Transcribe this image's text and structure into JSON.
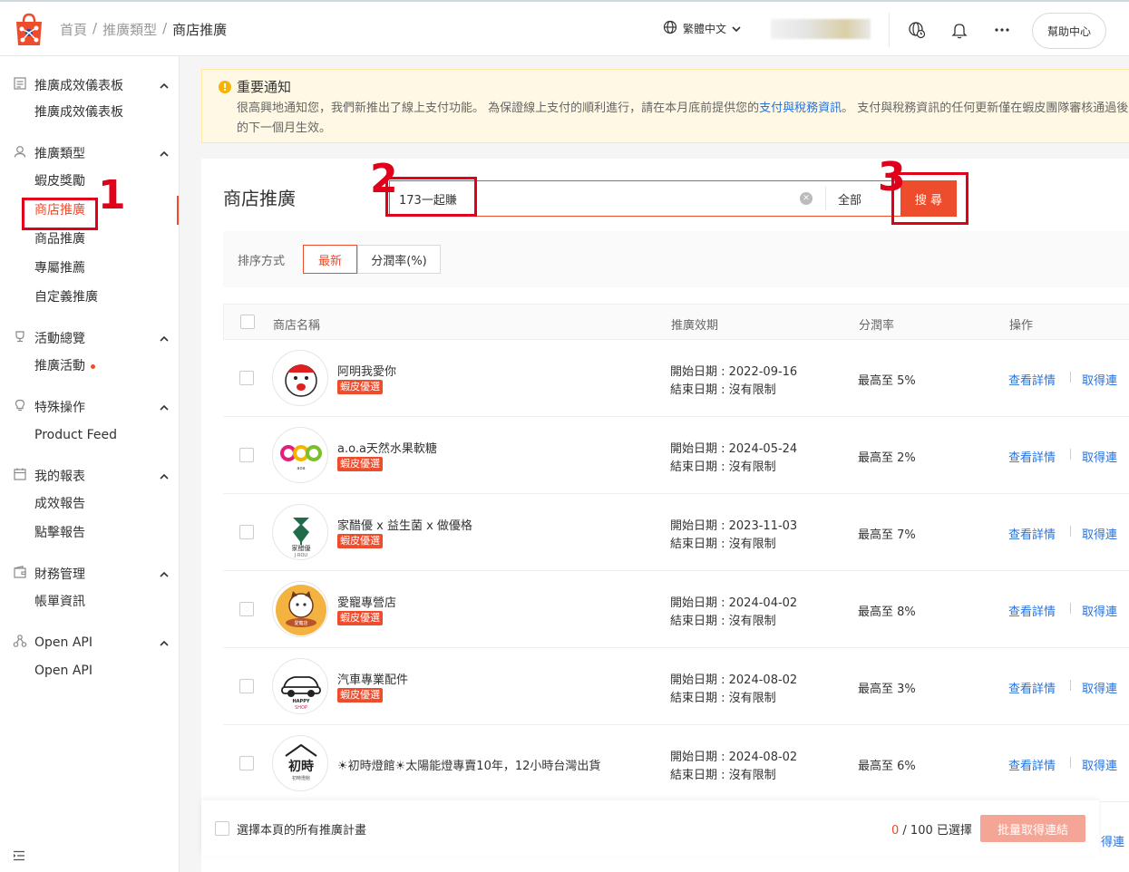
{
  "header": {
    "breadcrumb": [
      "首頁",
      "推廣類型",
      "商店推廣"
    ],
    "separator": "/",
    "language": "繁體中文",
    "help": "幫助中心"
  },
  "sidebar": {
    "sections": [
      {
        "title": "推廣成效儀表板",
        "icon": "dashboard-icon",
        "items": [
          {
            "label": "推廣成效儀表板"
          }
        ]
      },
      {
        "title": "推廣類型",
        "icon": "user-tag-icon",
        "items": [
          {
            "label": "蝦皮獎勵"
          },
          {
            "label": "商店推廣",
            "active": true
          },
          {
            "label": "商品推廣"
          },
          {
            "label": "專屬推薦"
          },
          {
            "label": "自定義推廣"
          }
        ]
      },
      {
        "title": "活動總覽",
        "icon": "trophy-icon",
        "items": [
          {
            "label": "推廣活動",
            "dot": true
          }
        ]
      },
      {
        "title": "特殊操作",
        "icon": "lightbulb-icon",
        "items": [
          {
            "label": "Product Feed"
          }
        ]
      },
      {
        "title": "我的報表",
        "icon": "calendar-icon",
        "items": [
          {
            "label": "成效報告"
          },
          {
            "label": "點擊報告"
          }
        ]
      },
      {
        "title": "財務管理",
        "icon": "wallet-icon",
        "items": [
          {
            "label": "帳單資訊"
          }
        ]
      },
      {
        "title": "Open API",
        "icon": "api-icon",
        "items": [
          {
            "label": "Open API"
          }
        ]
      }
    ]
  },
  "notice": {
    "title": "重要通知",
    "body_before": "很高興地通知您，我們新推出了線上支付功能。 為保證線上支付的順利進行，請在本月底前提供您的",
    "link": "支付與稅務資訊",
    "body_after": "。 支付與稅務資訊的任何更新僅在蝦皮團隊審核通過後的下一個月生效。"
  },
  "main": {
    "title": "商店推廣",
    "search": {
      "value": "173一起賺",
      "scope": "全部",
      "button": "搜 尋"
    },
    "sort": {
      "label": "排序方式",
      "options": [
        "最新",
        "分潤率(%)"
      ],
      "active": "最新"
    },
    "columns": [
      "商店名稱",
      "推廣效期",
      "分潤率",
      "操作"
    ],
    "rows": [
      {
        "name": "阿明我愛你",
        "badge": "蝦皮優選",
        "start": "開始日期 : 2022-09-16",
        "end": "結束日期 : 沒有限制",
        "rate": "最高至 5%",
        "detail": "查看詳情",
        "get": "取得連"
      },
      {
        "name": "a.o.a天然水果軟糖",
        "badge": "蝦皮優選",
        "start": "開始日期 : 2024-05-24",
        "end": "結束日期 : 沒有限制",
        "rate": "最高至 2%",
        "detail": "查看詳情",
        "get": "取得連"
      },
      {
        "name": "家醋優 x 益生菌 x 做優格",
        "badge": "蝦皮優選",
        "start": "開始日期 : 2023-11-03",
        "end": "結束日期 : 沒有限制",
        "rate": "最高至 7%",
        "detail": "查看詳情",
        "get": "取得連"
      },
      {
        "name": "愛寵專營店",
        "badge": "蝦皮優選",
        "start": "開始日期 : 2024-04-02",
        "end": "結束日期 : 沒有限制",
        "rate": "最高至 8%",
        "detail": "查看詳情",
        "get": "取得連"
      },
      {
        "name": "汽車專業配件",
        "badge": "蝦皮優選",
        "start": "開始日期 : 2024-08-02",
        "end": "結束日期 : 沒有限制",
        "rate": "最高至 3%",
        "detail": "查看詳情",
        "get": "取得連"
      },
      {
        "name": "☀初時燈館☀太陽能燈專賣10年，12小時台灣出貨",
        "badge": "",
        "start": "開始日期 : 2024-08-02",
        "end": "結束日期 : 沒有限制",
        "rate": "最高至 6%",
        "detail": "查看詳情",
        "get": "取得連"
      }
    ],
    "logos": [
      {
        "alt": "aming-logo"
      },
      {
        "alt": "aoa-logo",
        "text": "aoa"
      },
      {
        "alt": "jiarou-logo",
        "text": "家醋優",
        "sub": "J·ROU"
      },
      {
        "alt": "pet-logo",
        "text": "愛寵店"
      },
      {
        "alt": "car-logo",
        "text": "HAPPY",
        "sub": "SHOP"
      },
      {
        "alt": "chushi-logo",
        "text": "初時",
        "sub": "初時燈館"
      }
    ]
  },
  "footer": {
    "select_all": "選擇本頁的所有推廣計畫",
    "count_selected": "0",
    "count_total": "/ 100",
    "count_suffix": "已選擇",
    "batch_button": "批量取得連結",
    "edge_link": "得連"
  },
  "annotations": [
    "1",
    "2",
    "3"
  ],
  "colors": {
    "accent": "#ee4d2d",
    "link": "#2673dd",
    "annotation": "#e0001a",
    "notice_bg": "#fff8e4"
  }
}
